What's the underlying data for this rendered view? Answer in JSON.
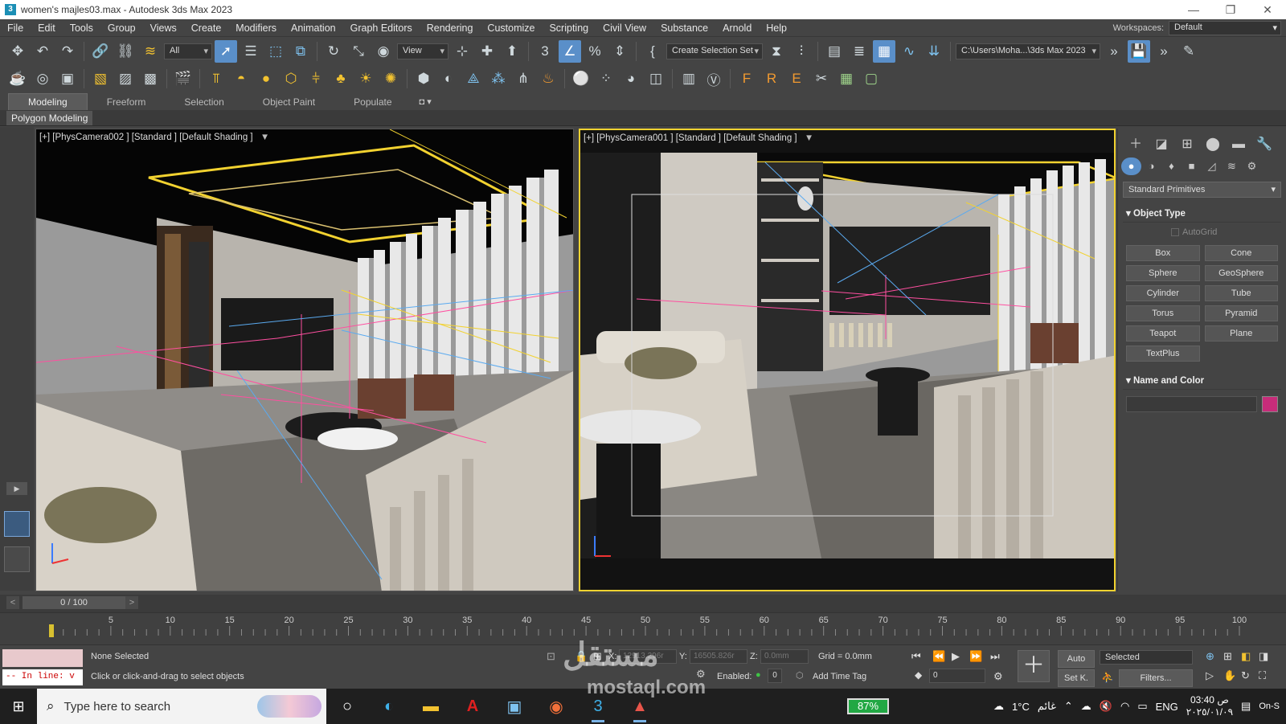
{
  "window": {
    "title": "women's majles03.max - Autodesk 3ds Max 2023",
    "app_icon": "3",
    "minimize": "—",
    "maximize": "❐",
    "close": "✕"
  },
  "menu": {
    "items": [
      "File",
      "Edit",
      "Tools",
      "Group",
      "Views",
      "Create",
      "Modifiers",
      "Animation",
      "Graph Editors",
      "Rendering",
      "Customize",
      "Scripting",
      "Civil View",
      "Substance",
      "Arnold",
      "Help"
    ],
    "workspace_label": "Workspaces:",
    "workspace_value": "Default"
  },
  "toolbar": {
    "filter_value": "All",
    "refcoord_value": "View",
    "selection_set_value": "Create Selection Set",
    "path_value": "C:\\Users\\Moha...\\3ds Max 2023"
  },
  "ribbon": {
    "tabs": [
      "Modeling",
      "Freeform",
      "Selection",
      "Object Paint",
      "Populate"
    ],
    "subpanel": "Polygon Modeling"
  },
  "viewports": {
    "left_label": "[+] [PhysCamera002 ] [Standard ] [Default Shading ]",
    "right_label": "[+] [PhysCamera001 ] [Standard ] [Default Shading ]"
  },
  "command_panel": {
    "dropdown": "Standard Primitives",
    "object_type_title": "Object Type",
    "autogrid": "AutoGrid",
    "buttons": [
      "Box",
      "Cone",
      "Sphere",
      "GeoSphere",
      "Cylinder",
      "Tube",
      "Torus",
      "Pyramid",
      "Teapot",
      "Plane",
      "TextPlus"
    ],
    "name_color_title": "Name and Color",
    "object_color": "#c72c7a"
  },
  "timeline": {
    "frame_display": "0 / 100",
    "prev": "<",
    "next": ">",
    "ticks": [
      "5",
      "10",
      "15",
      "20",
      "25",
      "30",
      "35",
      "40",
      "45",
      "50",
      "55",
      "60",
      "65",
      "70",
      "75",
      "80",
      "85",
      "90",
      "95",
      "100"
    ]
  },
  "status": {
    "script_text": "-- In line: v",
    "selection_status": "None Selected",
    "prompt": "Click or click-and-drag to select objects",
    "x_label": "X:",
    "x_value": "12913.296r",
    "y_label": "Y:",
    "y_value": "16505.826r",
    "z_label": "Z:",
    "z_value": "0.0mm",
    "grid": "Grid = 0.0mm",
    "enabled_label": "Enabled:",
    "enabled_value": "0",
    "add_time_tag": "Add Time Tag",
    "auto_button": "Auto",
    "key_mode": "Selected",
    "set_key_button": "Set K.",
    "filters_button": "Filters...",
    "frame_input": "0"
  },
  "watermark": {
    "arabic": "مستقل",
    "latin": "mostaql.com"
  },
  "taskbar": {
    "search_placeholder": "Type here to search",
    "battery": "87%",
    "temperature": "1°C",
    "weather": "غائم",
    "language": "ENG",
    "time": "03:40 ص",
    "date": "٢٠٢٥/٠١/٠٩",
    "on_screen": "On-S"
  },
  "colors": {
    "selection_accent": "#5a8fc9",
    "active_viewport_border": "#f2d230"
  }
}
